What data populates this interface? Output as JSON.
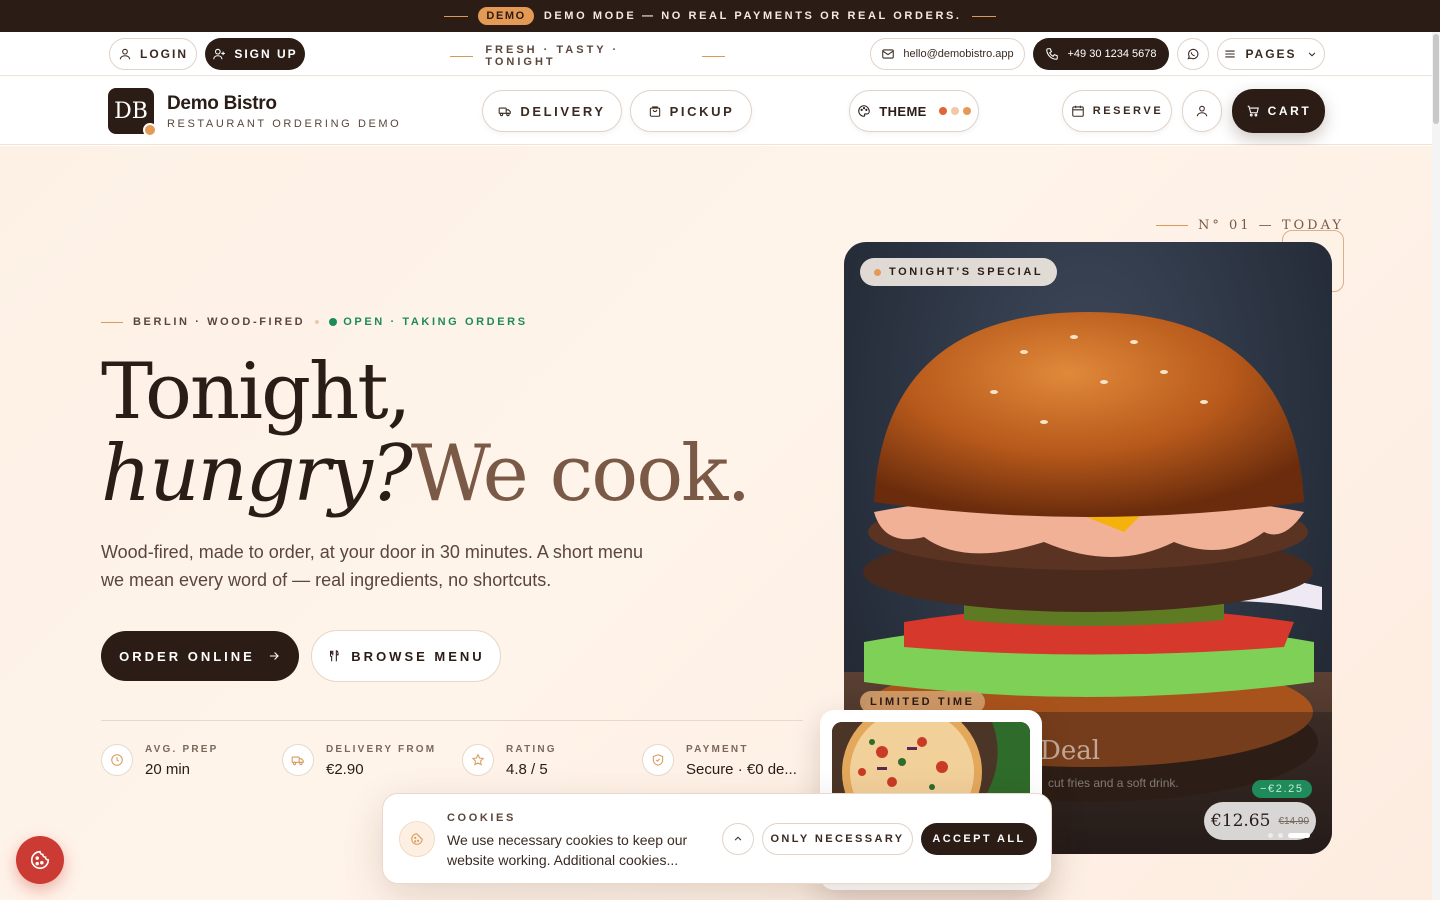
{
  "topbar": {
    "badge": "DEMO",
    "message": "DEMO MODE — NO REAL PAYMENTS OR REAL ORDERS."
  },
  "utility": {
    "login": "LOGIN",
    "signup": "SIGN UP",
    "tagline": "FRESH · TASTY · TONIGHT",
    "email": "hello@demobistro.app",
    "phone": "+49 30 1234 5678",
    "pages": "PAGES"
  },
  "header": {
    "logo_initials": "DB",
    "brand_name": "Demo Bistro",
    "brand_sub": "RESTAURANT ORDERING DEMO",
    "delivery": "DELIVERY",
    "pickup": "PICKUP",
    "theme": "THEME",
    "reserve": "RESERVE",
    "cart": "CART",
    "theme_colors": [
      "#e0663a",
      "#f0c9a8",
      "#e49a55"
    ]
  },
  "hero": {
    "eyebrow_location": "BERLIN · WOOD-FIRED",
    "eyebrow_status": "OPEN · TAKING ORDERS",
    "headline_1": "Tonight,",
    "headline_2": "hungry?",
    "headline_accent": "We cook.",
    "lead": "Wood-fired, made to order, at your door in 30 minutes. A short menu we mean every word of — real ingredients, no shortcuts.",
    "order_btn": "ORDER ONLINE",
    "browse_btn": "BROWSE MENU",
    "stats": [
      {
        "label": "AVG. PREP",
        "value": "20 min",
        "icon": "clock-icon"
      },
      {
        "label": "DELIVERY FROM",
        "value": "€2.90",
        "icon": "truck-icon"
      },
      {
        "label": "RATING",
        "value": "4.8 / 5",
        "icon": "star-icon"
      },
      {
        "label": "PAYMENT",
        "value": "Secure · €0 de...",
        "icon": "shield-icon"
      }
    ]
  },
  "showcase": {
    "number": "N° 01 — TODAY",
    "special": "TONIGHT'S SPECIAL",
    "limited": "LIMITED TIME",
    "deal_title": "Deal",
    "deal_desc": "cut fries and a soft drink.",
    "discount": "−€2.25",
    "price_now": "€12.65",
    "price_old": "€14.90"
  },
  "cookies": {
    "title": "COOKIES",
    "text": "We use necessary cookies to keep our website working. Additional cookies...",
    "only_necessary": "ONLY NECESSARY",
    "accept_all": "ACCEPT ALL"
  }
}
